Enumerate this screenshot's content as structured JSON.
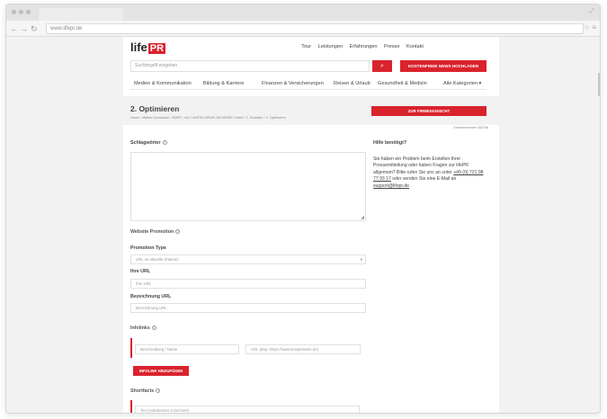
{
  "browser": {
    "url": "www.lifepr.de"
  },
  "site": {
    "logo_text": "life",
    "logo_mark": "PR",
    "topnav": [
      "Tour",
      "Leistungen",
      "Erfahrungen",
      "Presse",
      "Kontakt"
    ],
    "search_placeholder": "Suchbegriff eingeben",
    "search_icon_glyph": "⌕",
    "news_button": "KOSTENFREIE NEWS HOCHLADEN",
    "categories": [
      "Medien & Kommunikation",
      "Bildung & Karriere",
      "Finanzen & Versicherungen",
      "Reisen & Urlaub",
      "Gesundheit & Medizin",
      "Alle Kategorien ▾"
    ]
  },
  "step": {
    "title": "2. Optimieren",
    "breadcrumb": "Home › Mailen Goodreach › BNPR › ent / UNITED NEWS NETWORK GmbH › 1. Erstellen › 2. Optimieren",
    "firm_button": "ZUR FIRMENANSICHT",
    "customer_number": "Kundennummer 483766"
  },
  "form": {
    "keywords_label": "Schlagwörter",
    "help_icon": "?",
    "website_promotion_label": "Website Promotion",
    "promotion_type_label": "Promotion Type",
    "promotion_type_value": "URL im aktuelle (Pakete)",
    "url_label": "Ihre URL",
    "url_placeholder": "Ihre URL",
    "url_desc_label": "Bezeichnung URL",
    "url_desc_placeholder": "Bezeichnung URL",
    "infolinks_label": "Infolinks",
    "infolink_desc_placeholder": "Beschreibung / Name",
    "infolink_url_placeholder": "URL (Bsp. https://www.beispielseite.de)",
    "add_infolink_button": "INFOLINK HINZUFÜGEN",
    "shortfacts_label": "Shortfacts",
    "shortfacts_placeholder": "Text (mindestens 6 Zeichen)"
  },
  "help": {
    "title": "Hilfe benötigt?",
    "text": "Sie haben ein Problem beim Erstellen Ihrer Pressemitteilung oder haben Fragen zur lifePR allgemein? Bitte rufen Sie uns an unter",
    "phone": "+49 (0) 721 98 77 93 17",
    "mid": "oder senden Sie eine E-Mail an",
    "email": "support@lifepr.de"
  }
}
